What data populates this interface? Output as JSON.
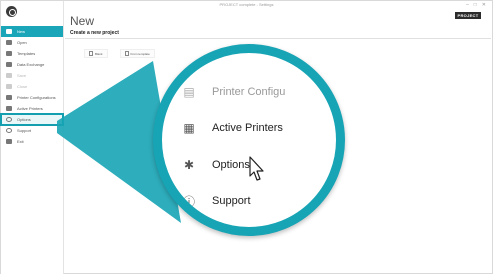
{
  "window": {
    "title": "PROJECT complete - Settings",
    "controls": [
      "–",
      "□",
      "✕"
    ]
  },
  "sidebar": {
    "items": [
      {
        "label": "New",
        "state": "active",
        "icon": "new-icon"
      },
      {
        "label": "Open",
        "state": "normal",
        "icon": "folder-icon"
      },
      {
        "label": "Templates",
        "state": "normal",
        "icon": "templates-icon"
      },
      {
        "label": "Data Exchange",
        "state": "normal",
        "icon": "data-exchange-icon"
      },
      {
        "label": "Save",
        "state": "disabled",
        "icon": "save-icon"
      },
      {
        "label": "Close",
        "state": "disabled",
        "icon": "close-icon"
      },
      {
        "label": "Printer Configurations",
        "state": "normal",
        "icon": "printer-config-icon"
      },
      {
        "label": "Active Printers",
        "state": "normal",
        "icon": "printer-icon"
      },
      {
        "label": "Options",
        "state": "highlighted",
        "icon": "gear-icon"
      },
      {
        "label": "Support",
        "state": "normal",
        "icon": "help-icon"
      },
      {
        "label": "Exit",
        "state": "normal",
        "icon": "exit-icon"
      }
    ]
  },
  "main": {
    "title": "New",
    "subtitle": "Create a new project",
    "brand": "PROJECT",
    "buttons": [
      {
        "label": "Blank",
        "icon": "document-icon"
      },
      {
        "label": "From template",
        "icon": "template-icon"
      }
    ]
  },
  "magnifier": {
    "items": [
      {
        "label": "Printer Configu",
        "icon": "printer-config-icon",
        "faded": true
      },
      {
        "label": "Active Printers",
        "icon": "printer-icon",
        "faded": false
      },
      {
        "label": "Options",
        "icon": "gear-icon",
        "faded": false
      },
      {
        "label": "Support",
        "icon": "help-icon",
        "faded": false
      }
    ]
  },
  "colors": {
    "accent": "#17a4b5",
    "active_nav": "#1ba5b8"
  }
}
